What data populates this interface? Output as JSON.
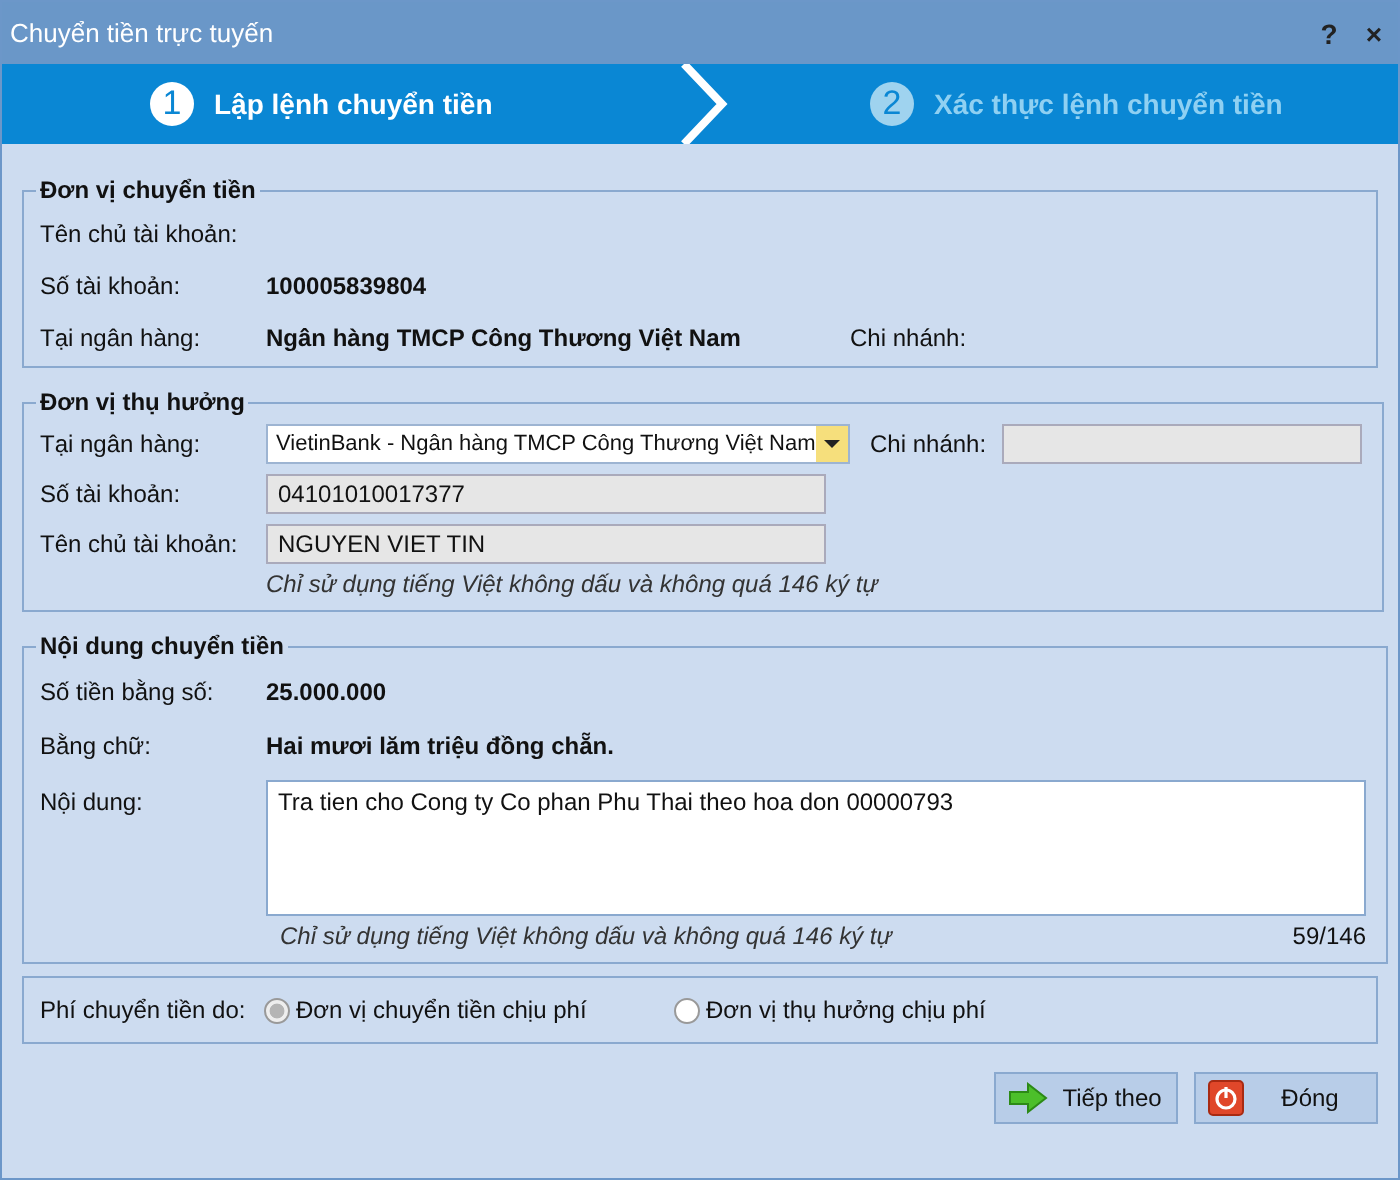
{
  "window": {
    "title": "Chuyển tiền trực tuyến",
    "help": "?",
    "close": "×"
  },
  "steps": [
    {
      "number": "1",
      "label": "Lập lệnh chuyển tiền",
      "selected": true
    },
    {
      "number": "2",
      "label": "Xác thực lệnh chuyển tiền",
      "selected": false
    }
  ],
  "sender": {
    "title": "Đơn vị chuyển tiền",
    "name_label": "Tên chủ tài khoản:",
    "account_label": "Số tài khoản:",
    "account": "100005839804",
    "bank_label": "Tại ngân hàng:",
    "bank": "Ngân hàng TMCP Công Thương Việt Nam",
    "branch_label": "Chi nhánh:"
  },
  "receiver": {
    "title": "Đơn vị thụ hưởng",
    "bank_label": "Tại ngân hàng:",
    "bank": "VietinBank - Ngân hàng TMCP Công Thương Việt Nam",
    "branch_label": "Chi nhánh:",
    "account_label": "Số tài khoản:",
    "account": "04101010017377",
    "name_label": "Tên chủ tài khoản:",
    "name": "NGUYEN VIET TIN",
    "hint": "Chỉ sử dụng tiếng Việt không dấu và không quá 146 ký tự"
  },
  "content": {
    "title": "Nội dung chuyển tiền",
    "amount_label": "Số tiền bằng số:",
    "amount": "25.000.000",
    "words_label": "Bằng chữ:",
    "words": "Hai mươi lăm triệu đồng chẵn.",
    "memo_label": "Nội dung:",
    "memo": "Tra tien cho Cong ty Co phan Phu Thai theo hoa don 00000793",
    "hint": "Chỉ sử dụng tiếng Việt không dấu và không quá 146 ký tự",
    "counter": "59/146"
  },
  "fee": {
    "label": "Phí chuyển tiền do:",
    "options": [
      {
        "label": "Đơn vị chuyển tiền chịu phí",
        "selected": true
      },
      {
        "label": "Đơn vị thụ hưởng chịu phí",
        "selected": false
      }
    ]
  },
  "buttons": [
    {
      "label": "Tiếp theo",
      "kind": "next"
    },
    {
      "label": "Đóng",
      "kind": "close"
    }
  ]
}
